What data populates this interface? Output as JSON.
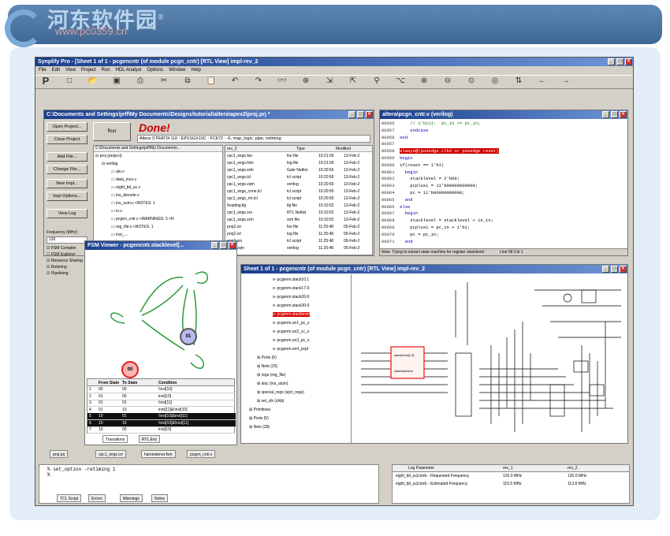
{
  "banner": {
    "title": "河东软件园",
    "reg_mark": "®",
    "watermark": "www.pc0359.cn"
  },
  "app": {
    "title": "Synplify Pro - [Sheet 1 of 1 - pcgencntr (of module pcgn_cntr) [RTL View] impl-rev_2",
    "menu": [
      "File",
      "Edit",
      "View",
      "Project",
      "Run",
      "HDL Analyst",
      "Options",
      "Window",
      "Help"
    ],
    "toolbar_icons": [
      "P",
      "new-icon",
      "open-icon",
      "save-icon",
      "print-icon",
      "cut-icon",
      "copy-icon",
      "paste-icon",
      "undo-icon",
      "redo-icon",
      "binoculars-icon",
      "zoom-icon",
      "push-icon",
      "pop-icon",
      "filter-icon",
      "hier-icon",
      "zoom-in-icon",
      "zoom-out-icon",
      "zoom-fit-icon",
      "zoom-full-icon",
      "flatten-icon",
      "back-icon",
      "forward-icon"
    ]
  },
  "project": {
    "title": "C:\\Documents and Settings\\jeff\\My Documents\\Designs\\tutorial\\altera\\apex2\\proj.prj *",
    "buttons": [
      "Open Project...",
      "Close Project",
      "Add File...",
      "Change File...",
      "New Impl...",
      "Impl Options...",
      "View Log"
    ],
    "run_label": "Run",
    "status": "Done!",
    "device_line": "Altera STRATIX GX : EP1SGX10C : FC672 : -6, map_logic, pipe, retiming",
    "tree_header": "C:\\Documents and Settings\\jeff\\My Documents...",
    "tree": [
      "proj (project)",
      "verilog",
      "alu.v",
      "data_mux.v",
      "eight_bit_uc.v",
      "ins_decode.v",
      "ins_sum.v <NOTES: 1",
      "io.v",
      "pcgen_cntr.v <WARNINGS: 3 <N",
      "reg_file.v <NOTES: 1",
      "inst_..."
    ],
    "freq_label": "Frequency (MHz):",
    "freq_value": "120",
    "options": [
      "FSM Compiler",
      "FSM Explorer",
      "Resource Sharing",
      "Retiming",
      "Pipelining"
    ],
    "file_columns": [
      "rev_2",
      "Type",
      "Modified"
    ],
    "files": [
      [
        "cpc1_wrgs.fse",
        "fse file",
        "10:21:09",
        "13-Feb-2"
      ],
      [
        "cpc1_wrgs.htm",
        "log file",
        "10:21:09",
        "13-Feb-2"
      ],
      [
        "cpc1_wrgs.edn",
        "Gate Netlist",
        "10:20:59",
        "13-Feb-2"
      ],
      [
        "cpc1_wrgs.tcl",
        "tcl script",
        "10:20:59",
        "13-Feb-2"
      ],
      [
        "cpc1_wrgs.vqm",
        "verilog",
        "10:20:59",
        "13-Feb-2"
      ],
      [
        "cpc1_wrgs_cons.tcl",
        "tcl script",
        "10:20:59",
        "13-Feb-2"
      ],
      [
        "cpc1_wrgs_rm.tcl",
        "tcl script",
        "10:20:59",
        "13-Feb-2"
      ],
      [
        "fsoptlog.tlg",
        "tlg file",
        "10:10:52",
        "13-Feb-2"
      ],
      [
        "cpc1_wrgs.srs",
        "RTL Netlist",
        "10:10:52",
        "13-Feb-2"
      ],
      [
        "cpc1_wrgs.srm",
        "srm file",
        "10:10:52",
        "13-Feb-2"
      ],
      [
        "proj2.srr",
        "fse file",
        "11:25:48",
        "05-Feb-2"
      ],
      [
        "proj2.srl",
        "log file",
        "11:25:48",
        "05-Feb-2"
      ],
      [
        "proj2.srs",
        "tcl script",
        "11:25:48",
        "05-Feb-2"
      ],
      [
        "proj2.vqm",
        "verilog",
        "11:25:48",
        "05-Feb-2"
      ]
    ]
  },
  "editor": {
    "title": "altera\\pcgn_cntr.v (verilog)",
    "lines": [
      [
        "00056",
        "    // 3'b111:  pc_in <= pc_in;",
        "cm"
      ],
      [
        "00057",
        "    endcase",
        "kw"
      ],
      [
        "00058",
        "end",
        "kw"
      ],
      [
        "00057",
        "",
        ""
      ],
      [
        "00058",
        "always@(posedge clk6 or posedge reset)",
        "kw"
      ],
      [
        "00059",
        "begin",
        "kw"
      ],
      [
        "00060",
        "if(reset == 1'b1)",
        ""
      ],
      [
        "00061",
        "  begin",
        "kw"
      ],
      [
        "00062",
        "    stacklevel = 2'b00;",
        ""
      ],
      [
        "00063",
        "    pcplus1 = 11'b00000000000;",
        ""
      ],
      [
        "00064",
        "    pc = 11'b00000000000;",
        ""
      ],
      [
        "00065",
        "  end",
        "kw"
      ],
      [
        "00066",
        "else",
        "kw"
      ],
      [
        "00067",
        "  begin",
        "kw"
      ],
      [
        "00068",
        "    stacklevel = stacklevel + in_in;",
        ""
      ],
      [
        "00069",
        "    pcplus1 = pc_in + 1'b1;",
        ""
      ],
      [
        "00070",
        "    pc = pc_in;",
        ""
      ],
      [
        "00071",
        "  end",
        "kw"
      ]
    ],
    "note": "Note: Trying to extract state machine for register stacklevel",
    "line_col": "Line 58 Col 1"
  },
  "fsm": {
    "title": "FSM Viewer - pcgencntr.stacklevel[...",
    "states": [
      "00",
      "01",
      "10"
    ],
    "columns": [
      "",
      "From State",
      "To State",
      "Condition"
    ],
    "rows": [
      [
        "1",
        "00",
        "00",
        "!inst[10]"
      ],
      [
        "2",
        "01",
        "00",
        "inst[10]"
      ],
      [
        "3",
        "01",
        "01",
        "!inst[11]"
      ],
      [
        "4",
        "01",
        "10",
        "inst[11]&!inst[10]"
      ],
      [
        "5",
        "10",
        "01",
        "!inst[10]&inst[11]"
      ],
      [
        "6",
        "10",
        "10",
        "!inst[10]&!inst[11]"
      ],
      [
        "7",
        "10",
        "00",
        "inst[10]"
      ]
    ],
    "tabs": [
      "Transitions",
      "RTL Enc"
    ]
  },
  "rtl": {
    "title": "Sheet 1 of 1 - pcgencntr (of module pcgn_cntr) [RTL View] impl-rev_2",
    "tree": [
      "pcgenm.stack10.1",
      "pcgenm.stack17-0",
      "pcgenm.stack20-0",
      "pcgenm.stack30-0",
      "pcgenm.stacklevel",
      "pcgenm.un1_pc_s",
      "pcgenm.un2_cc_s",
      "pcgenm.un3_pc_s",
      "pcgenm.un4_pcpl",
      "Ports (6)",
      "Nets (25)",
      "regs (reg_file)",
      "aluc (ins_alum)",
      "special_regs (spcl_regs)",
      "sel_clk (clkb)",
      "Primitives",
      "Ports (5)",
      "Nets (28)"
    ],
    "highlight": "pcgenm.stacklevel",
    "labels": [
      "stacklevel[1:0]",
      "statemachine"
    ]
  },
  "bottom": {
    "tabs": [
      "proj.prj",
      "cpc1_wrgs.srr",
      "harvestener.fsm",
      "pcgen_cntr.v"
    ],
    "console": [
      "% set_option -retiming 1",
      "%"
    ],
    "console_tabs": [
      "TCL Script",
      "Errors",
      "Warnings",
      "Notes"
    ],
    "timing_columns": [
      "Log Parameter",
      "rev_1",
      "rev_2"
    ],
    "timing_rows": [
      [
        "eight_bit_uc|clock - Requested Frequency",
        "120.0 MHz",
        "120.0 MHz"
      ],
      [
        "eight_bit_uc|clock - Estimated Frequency",
        "115.5 MHz",
        "113.8 MHz"
      ]
    ]
  }
}
